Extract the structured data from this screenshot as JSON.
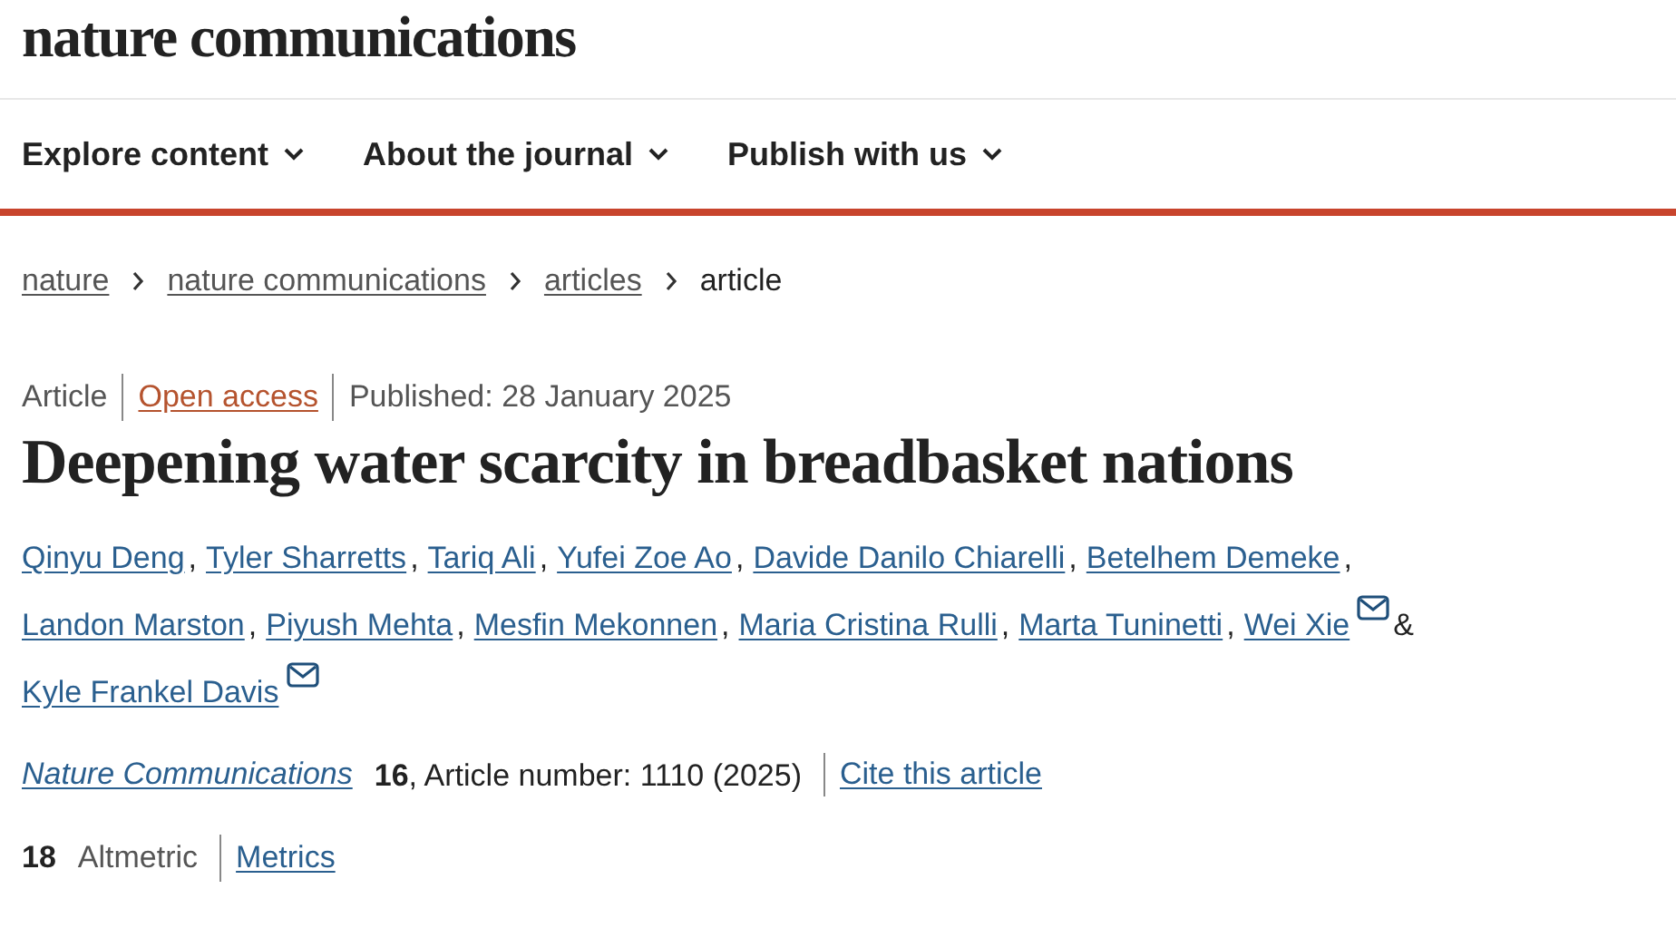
{
  "site": {
    "logo": "nature communications"
  },
  "nav": [
    {
      "label": "Explore content",
      "caret": true
    },
    {
      "label": "About the journal",
      "caret": true
    },
    {
      "label": "Publish with us",
      "caret": true
    }
  ],
  "breadcrumbs": [
    {
      "label": "nature",
      "link": true
    },
    {
      "label": "nature communications",
      "link": true
    },
    {
      "label": "articles",
      "link": true
    },
    {
      "label": "article",
      "link": false
    }
  ],
  "article": {
    "type": "Article",
    "access": "Open access",
    "published": "Published: 28 January 2025",
    "title": "Deepening water scarcity in breadbasket nations",
    "authors": [
      {
        "name": "Qinyu Deng",
        "email": false,
        "after": ","
      },
      {
        "name": "Tyler Sharretts",
        "email": false,
        "after": ","
      },
      {
        "name": "Tariq Ali",
        "email": false,
        "after": ","
      },
      {
        "name": "Yufei Zoe Ao",
        "email": false,
        "after": ","
      },
      {
        "name": "Davide Danilo Chiarelli",
        "email": false,
        "after": ","
      },
      {
        "name": "Betelhem Demeke",
        "email": false,
        "after": ","
      },
      {
        "name": "Landon Marston",
        "email": false,
        "after": ","
      },
      {
        "name": "Piyush Mehta",
        "email": false,
        "after": ","
      },
      {
        "name": "Mesfin Mekonnen",
        "email": false,
        "after": ","
      },
      {
        "name": "Maria Cristina Rulli",
        "email": false,
        "after": ","
      },
      {
        "name": "Marta Tuninetti",
        "email": false,
        "after": ","
      },
      {
        "name": "Wei Xie",
        "email": true,
        "after": "&"
      },
      {
        "name": "Kyle Frankel Davis",
        "email": true
      }
    ],
    "journal": "Nature Communications",
    "citation": "**16**, Article number: 1110 (2025)",
    "cite_link": "Cite this article",
    "altmetric_score": "18",
    "altmetric_label": "Altmetric",
    "metrics_link": "Metrics"
  }
}
